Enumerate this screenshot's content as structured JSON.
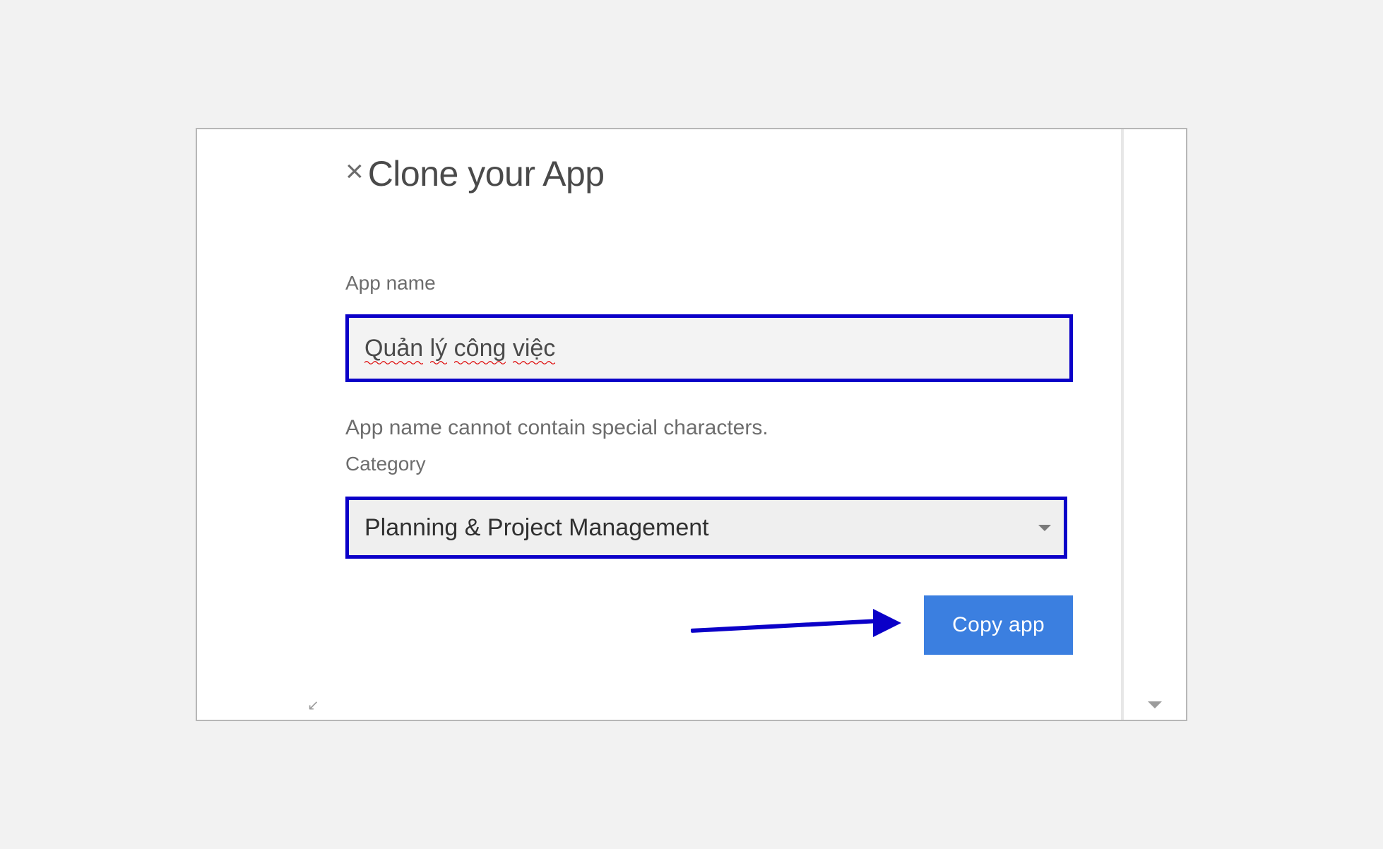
{
  "dialog": {
    "title": "Clone your App",
    "close_icon": "close-icon"
  },
  "form": {
    "app_name_label": "App name",
    "app_name_value_word1": "Quản",
    "app_name_value_word2": "lý",
    "app_name_value_word3": "công",
    "app_name_value_word4": "việc",
    "validation_message": "App name cannot contain special characters.",
    "category_label": "Category",
    "category_value": "Planning & Project Management"
  },
  "actions": {
    "copy_button": "Copy app"
  }
}
